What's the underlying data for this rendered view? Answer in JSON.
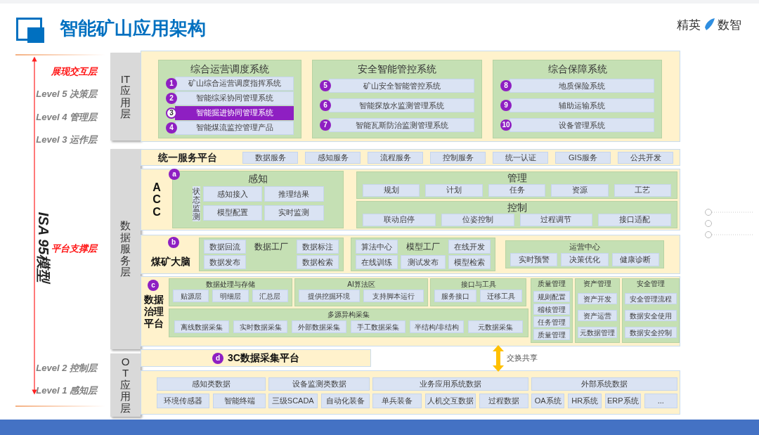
{
  "title": "智能矿山应用架构",
  "brand": [
    "精英",
    "数智"
  ],
  "left_axis": {
    "title": "ISA 95模型",
    "groups": [
      [
        {
          "kind": "tier",
          "text": "展现交互层"
        },
        {
          "kind": "level",
          "text": "Level 5 决策层"
        },
        {
          "kind": "level",
          "text": "Level 4 管理层"
        },
        {
          "kind": "level",
          "text": "Level 3 运作层"
        }
      ],
      [
        {
          "kind": "tier",
          "text": "平台支撑层"
        }
      ],
      [
        {
          "kind": "level",
          "text": "Level 2 控制层"
        },
        {
          "kind": "level",
          "text": "Level 1 感知层"
        }
      ]
    ]
  },
  "layers": [
    "IT应用层",
    "数据服务层",
    "OT应用层"
  ],
  "it_systems": [
    {
      "title": "综合运营调度系统",
      "items": [
        {
          "num": "1",
          "text": "矿山综合运营调度指挥系统",
          "selected": false
        },
        {
          "num": "2",
          "text": "智能综采协同管理系统",
          "selected": false
        },
        {
          "num": "3",
          "text": "智能掘进协同管理系统",
          "selected": true
        },
        {
          "num": "4",
          "text": "智能煤流监控管理产品",
          "selected": false
        }
      ]
    },
    {
      "title": "安全智能管控系统",
      "items": [
        {
          "num": "5",
          "text": "矿山安全智能管控系统",
          "selected": false
        },
        {
          "num": "6",
          "text": "智能探放水监测管理系统",
          "selected": false
        },
        {
          "num": "7",
          "text": "智能瓦斯防治监测管理系统",
          "selected": false
        }
      ]
    },
    {
      "title": "综合保障系统",
      "items": [
        {
          "num": "8",
          "text": "地质保险系统",
          "selected": false
        },
        {
          "num": "9",
          "text": "辅助运输系统",
          "selected": false
        },
        {
          "num": "10",
          "text": "设备管理系统",
          "selected": false
        }
      ]
    }
  ],
  "service_platform": {
    "title": "统一服务平台",
    "items": [
      "数据服务",
      "感知服务",
      "流程服务",
      "控制服务",
      "统一认证",
      "GIS服务",
      "公共开发"
    ]
  },
  "acc": {
    "badge": "a",
    "title": "ACC",
    "perception": {
      "title": "感知",
      "side": "状态监测",
      "items": [
        "感知接入",
        "推理结果",
        "模型配置",
        "实时监测"
      ]
    },
    "management": {
      "title": "管理",
      "items": [
        "规划",
        "计划",
        "任务",
        "资源",
        "工艺"
      ]
    },
    "control": {
      "title": "控制",
      "items": [
        "联动启停",
        "位姿控制",
        "过程调节",
        "接口适配"
      ]
    }
  },
  "brain": {
    "badge": "b",
    "title": "煤矿大脑",
    "groups": [
      {
        "kind": "factory",
        "title": "数据工厂",
        "left": [
          "数据回流",
          "数据发布"
        ],
        "right": [
          "数据标注",
          "数据检索"
        ]
      },
      {
        "kind": "factory",
        "title": "模型工厂",
        "left": [
          "算法中心",
          "在线训练"
        ],
        "center": [
          "测试发布"
        ],
        "right": [
          "在线开发",
          "模型检索"
        ]
      },
      {
        "kind": "center",
        "title": "运营中心",
        "items": [
          "实时预警",
          "决策优化",
          "健康诊断"
        ]
      }
    ]
  },
  "governance": {
    "badge": "c",
    "title": "数据治理平台",
    "modules": [
      {
        "title": "数据处理与存储",
        "items": [
          "贴源层",
          "明细层",
          "汇总层"
        ]
      },
      {
        "title": "AI算法区",
        "items": [
          "提供挖掘环境",
          "支持脚本运行"
        ]
      },
      {
        "title": "接口与工具",
        "items": [
          "服务接口",
          "迁移工具"
        ]
      }
    ],
    "collection": {
      "title": "多源异构采集",
      "items": [
        "离线数据采集",
        "实时数据采集",
        "外部数据采集",
        "手工数据采集",
        "半结构/非结构",
        "元数据采集"
      ]
    },
    "side_panels": [
      {
        "title": "质量管理",
        "items": [
          "规则配置",
          "稽核管理",
          "任务管理",
          "质量管理"
        ]
      },
      {
        "title": "资产管理",
        "items": [
          "资产开发",
          "资产运营",
          "元数据管理"
        ]
      },
      {
        "title": "安全管理",
        "items": [
          "安全管理流程",
          "数据安全使用",
          "数据安全控制"
        ]
      }
    ]
  },
  "collection_platform": {
    "badge": "d",
    "title": "3C数据采集平台"
  },
  "exchange": "交换共享",
  "ot_data": [
    {
      "title": "感知类数据",
      "items": [
        "环境传感器",
        "智能终端"
      ]
    },
    {
      "title": "设备监测类数据",
      "items": [
        "三级SCADA",
        "自动化装备"
      ]
    },
    {
      "title": "业务应用系统数据",
      "items": [
        "单兵装备",
        "人机交互数据",
        "过程数据"
      ]
    },
    {
      "title": "外部系统数据",
      "items": [
        "OA系统",
        "HR系统",
        "ERP系统",
        "..."
      ]
    }
  ]
}
